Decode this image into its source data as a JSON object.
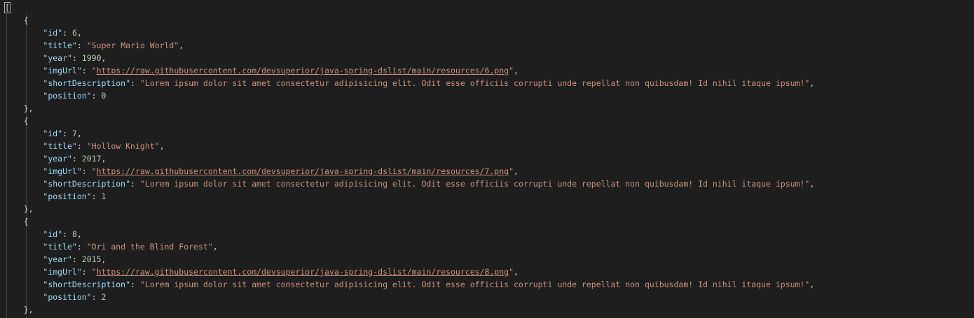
{
  "root_open": "[",
  "items": [
    {
      "id": "6",
      "title": "Super Mario World",
      "year": "1990",
      "imgUrl": "https://raw.githubusercontent.com/devsuperior/java-spring-dslist/main/resources/6.png",
      "shortDescription": "Lorem ipsum dolor sit amet consectetur adipisicing elit. Odit esse officiis corrupti unde repellat non quibusdam! Id nihil itaque ipsum!",
      "position": "0"
    },
    {
      "id": "7",
      "title": "Hollow Knight",
      "year": "2017",
      "imgUrl": "https://raw.githubusercontent.com/devsuperior/java-spring-dslist/main/resources/7.png",
      "shortDescription": "Lorem ipsum dolor sit amet consectetur adipisicing elit. Odit esse officiis corrupti unde repellat non quibusdam! Id nihil itaque ipsum!",
      "position": "1"
    },
    {
      "id": "8",
      "title": "Ori and the Blind Forest",
      "year": "2015",
      "imgUrl": "https://raw.githubusercontent.com/devsuperior/java-spring-dslist/main/resources/8.png",
      "shortDescription": "Lorem ipsum dolor sit amet consectetur adipisicing elit. Odit esse officiis corrupti unde repellat non quibusdam! Id nihil itaque ipsum!",
      "position": "2"
    }
  ],
  "keys": {
    "id": "\"id\"",
    "title": "\"title\"",
    "year": "\"year\"",
    "imgUrl": "\"imgUrl\"",
    "shortDescription": "\"shortDescription\"",
    "position": "\"position\""
  },
  "colors": {
    "background": "#1e1e1e",
    "key": "#9cdcfe",
    "string": "#ce9178",
    "number": "#b5cea8",
    "punctuation": "#d4d4d4"
  }
}
